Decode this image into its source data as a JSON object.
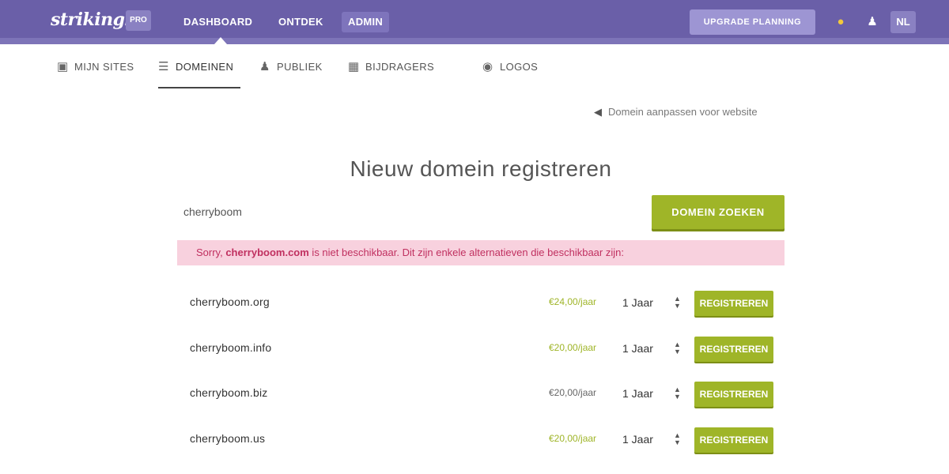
{
  "topbar": {
    "logo": "strikingly",
    "pro_badge": "PRO",
    "nav": [
      "DASHBOARD",
      "ONTDEK",
      "ADMIN"
    ],
    "upgrade": "UPGRADE PLANNING",
    "lang": "NL",
    "icons": [
      "lightbulb-icon",
      "user-icon"
    ]
  },
  "subnav": {
    "items": [
      {
        "label": "MIJN SITES",
        "icon": "sites-icon"
      },
      {
        "label": "DOMEINEN",
        "icon": "domains-icon"
      },
      {
        "label": "PUBLIEK",
        "icon": "audience-icon"
      },
      {
        "label": "BIJDRAGERS",
        "icon": "contributors-icon"
      },
      {
        "label": "LOGOS",
        "icon": "logo-icon"
      }
    ]
  },
  "back_link": "Domein aanpassen voor website",
  "page_title": "Nieuw domein registreren",
  "search": {
    "value": "cherryboom",
    "button": "DOMEIN ZOEKEN"
  },
  "alert": {
    "prefix": "Sorry, ",
    "domain": "cherryboom.com",
    "suffix": " is niet beschikbaar. Dit zijn enkele alternatieven die beschikbaar zijn:"
  },
  "results": [
    {
      "name": "cherryboom.org",
      "price": "€24,00/jaar",
      "term": "1 Jaar",
      "buy": "REGISTREREN"
    },
    {
      "name": "cherryboom.info",
      "price": "€20,00/jaar",
      "term": "1 Jaar",
      "buy": "REGISTREREN"
    },
    {
      "name": "cherryboom.biz",
      "price": "€20,00/jaar",
      "term": "1 Jaar",
      "buy": "REGISTREREN"
    },
    {
      "name": "cherryboom.us",
      "price": "€20,00/jaar",
      "term": "1 Jaar",
      "buy": "REGISTREREN"
    }
  ],
  "colors": {
    "topbar": "#6a5fa8",
    "accent_green": "#9fb528",
    "alert_bg": "#f8d1de",
    "alert_text": "#c03060"
  }
}
